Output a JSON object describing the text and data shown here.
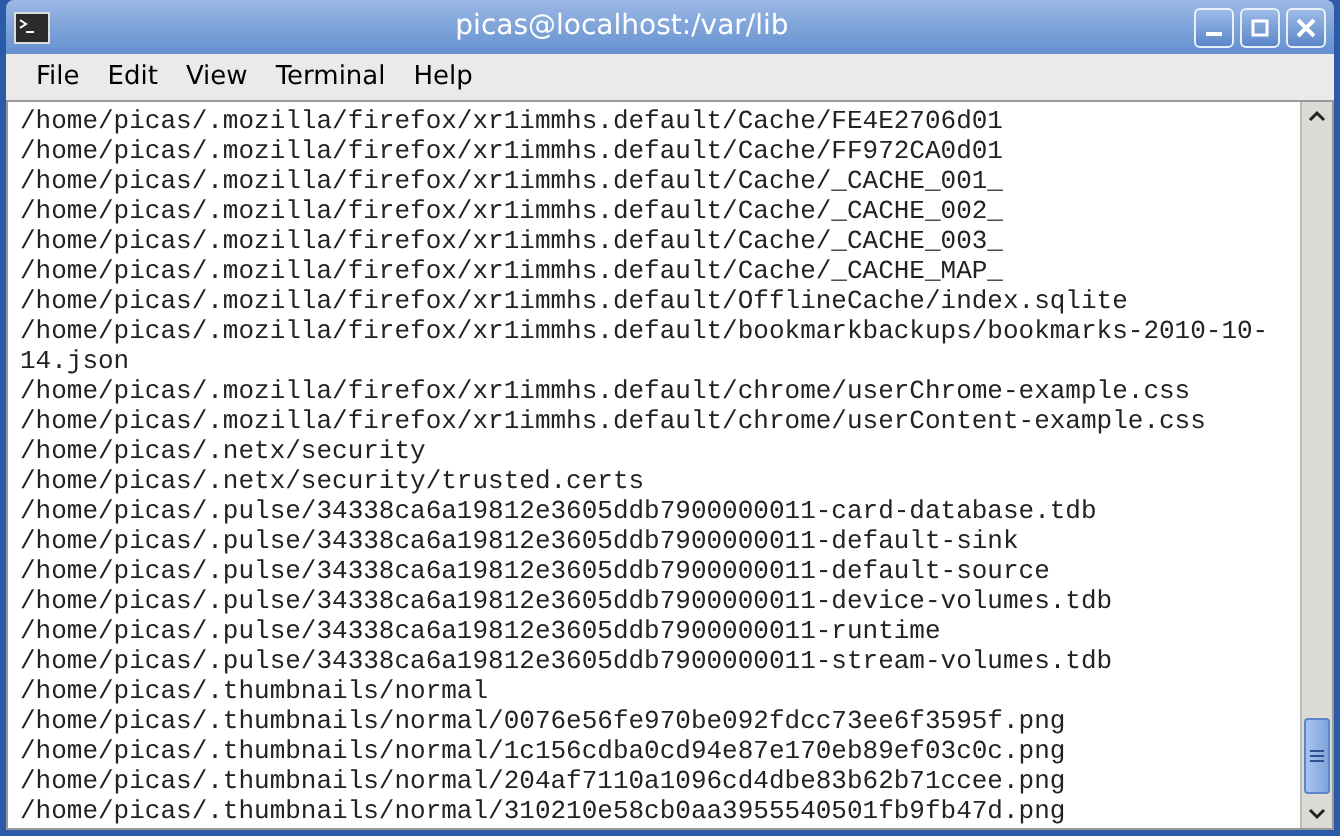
{
  "window": {
    "title": "picas@localhost:/var/lib"
  },
  "menu": [
    "File",
    "Edit",
    "View",
    "Terminal",
    "Help"
  ],
  "terminal": {
    "lines": [
      "/home/picas/.mozilla/firefox/xr1immhs.default/Cache/FE4E2706d01",
      "/home/picas/.mozilla/firefox/xr1immhs.default/Cache/FF972CA0d01",
      "/home/picas/.mozilla/firefox/xr1immhs.default/Cache/_CACHE_001_",
      "/home/picas/.mozilla/firefox/xr1immhs.default/Cache/_CACHE_002_",
      "/home/picas/.mozilla/firefox/xr1immhs.default/Cache/_CACHE_003_",
      "/home/picas/.mozilla/firefox/xr1immhs.default/Cache/_CACHE_MAP_",
      "/home/picas/.mozilla/firefox/xr1immhs.default/OfflineCache/index.sqlite",
      "/home/picas/.mozilla/firefox/xr1immhs.default/bookmarkbackups/bookmarks-2010-10-",
      "14.json",
      "/home/picas/.mozilla/firefox/xr1immhs.default/chrome/userChrome-example.css",
      "/home/picas/.mozilla/firefox/xr1immhs.default/chrome/userContent-example.css",
      "/home/picas/.netx/security",
      "/home/picas/.netx/security/trusted.certs",
      "/home/picas/.pulse/34338ca6a19812e3605ddb7900000011-card-database.tdb",
      "/home/picas/.pulse/34338ca6a19812e3605ddb7900000011-default-sink",
      "/home/picas/.pulse/34338ca6a19812e3605ddb7900000011-default-source",
      "/home/picas/.pulse/34338ca6a19812e3605ddb7900000011-device-volumes.tdb",
      "/home/picas/.pulse/34338ca6a19812e3605ddb7900000011-runtime",
      "/home/picas/.pulse/34338ca6a19812e3605ddb7900000011-stream-volumes.tdb",
      "/home/picas/.thumbnails/normal",
      "/home/picas/.thumbnails/normal/0076e56fe970be092fdcc73ee6f3595f.png",
      "/home/picas/.thumbnails/normal/1c156cdba0cd94e87e170eb89ef03c0c.png",
      "/home/picas/.thumbnails/normal/204af7110a1096cd4dbe83b62b71ccee.png",
      "/home/picas/.thumbnails/normal/310210e58cb0aa3955540501fb9fb47d.png"
    ]
  }
}
